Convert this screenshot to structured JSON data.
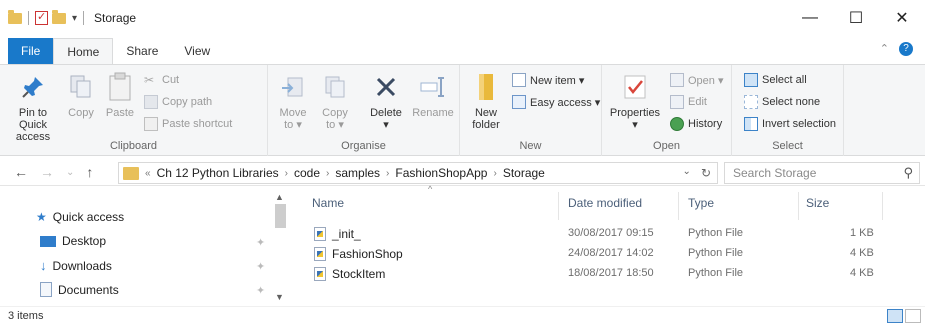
{
  "window": {
    "title": "Storage",
    "controls": {
      "minimize": "—",
      "maximize": "☐",
      "close": "✕"
    }
  },
  "tabs": [
    {
      "label": "File"
    },
    {
      "label": "Home"
    },
    {
      "label": "Share"
    },
    {
      "label": "View"
    }
  ],
  "ribbon": {
    "clipboard": {
      "label": "Clipboard",
      "pin_to_quick_access_1": "Pin to Quick",
      "pin_to_quick_access_2": "access",
      "copy": "Copy",
      "paste": "Paste",
      "cut": "Cut",
      "copy_path": "Copy path",
      "paste_shortcut": "Paste shortcut"
    },
    "organise": {
      "label": "Organise",
      "move_to_1": "Move",
      "move_to_2": "to ▾",
      "copy_to_1": "Copy",
      "copy_to_2": "to ▾",
      "delete": "Delete",
      "delete_arrow": "▾",
      "rename": "Rename"
    },
    "new": {
      "label": "New",
      "new_folder_1": "New",
      "new_folder_2": "folder",
      "new_item": "New item ▾",
      "easy_access": "Easy access ▾"
    },
    "open": {
      "label": "Open",
      "properties": "Properties",
      "properties_arrow": "▾",
      "open": "Open ▾",
      "edit": "Edit",
      "history": "History"
    },
    "select": {
      "label": "Select",
      "select_all": "Select all",
      "select_none": "Select none",
      "invert_selection": "Invert selection"
    }
  },
  "address": {
    "overflow": "«",
    "crumbs": [
      "Ch 12 Python Libraries",
      "code",
      "samples",
      "FashionShopApp",
      "Storage"
    ],
    "search_placeholder": "Search Storage"
  },
  "nav": {
    "quick_access": "Quick access",
    "items": [
      {
        "label": "Desktop"
      },
      {
        "label": "Downloads"
      },
      {
        "label": "Documents"
      }
    ]
  },
  "columns": {
    "name": "Name",
    "date": "Date modified",
    "type": "Type",
    "size": "Size"
  },
  "files": [
    {
      "name": "_init_",
      "date": "30/08/2017 09:15",
      "type": "Python File",
      "size": "1 KB"
    },
    {
      "name": "FashionShop",
      "date": "24/08/2017 14:02",
      "type": "Python File",
      "size": "4 KB"
    },
    {
      "name": "StockItem",
      "date": "18/08/2017 18:50",
      "type": "Python File",
      "size": "4 KB"
    }
  ],
  "status": {
    "item_count": "3 items"
  },
  "colors": {
    "accent": "#1979ca",
    "folder": "#e8c05a",
    "ribbon_bg": "#f5f6f7"
  }
}
